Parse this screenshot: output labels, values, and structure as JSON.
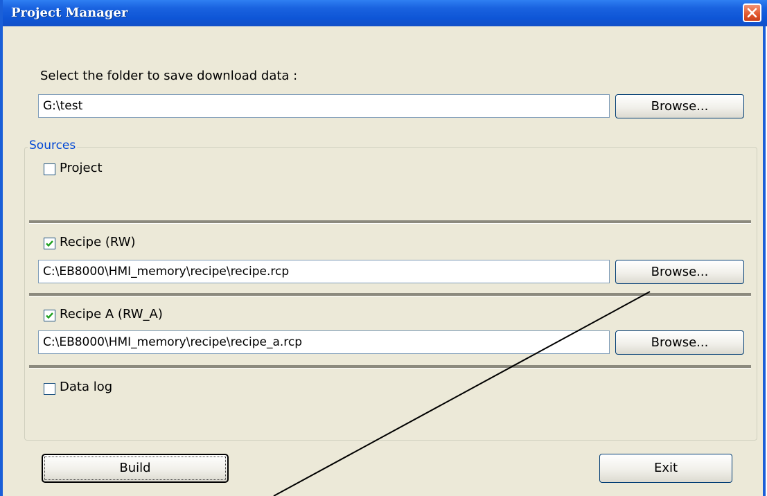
{
  "window": {
    "title": "Project Manager"
  },
  "folder": {
    "label": "Select the folder to save download data :",
    "path": "G:\\test",
    "browse_label": "Browse..."
  },
  "sources": {
    "title": "Sources",
    "project": {
      "label": "Project",
      "checked": false
    },
    "recipe": {
      "label": "Recipe (RW)",
      "checked": true,
      "path": "C:\\EB8000\\HMI_memory\\recipe\\recipe.rcp",
      "browse_label": "Browse..."
    },
    "recipe_a": {
      "label": "Recipe A (RW_A)",
      "checked": true,
      "path": "C:\\EB8000\\HMI_memory\\recipe\\recipe_a.rcp",
      "browse_label": "Browse..."
    },
    "datalog": {
      "label": "Data log",
      "checked": false
    }
  },
  "footer": {
    "build_label": "Build",
    "exit_label": "Exit"
  }
}
